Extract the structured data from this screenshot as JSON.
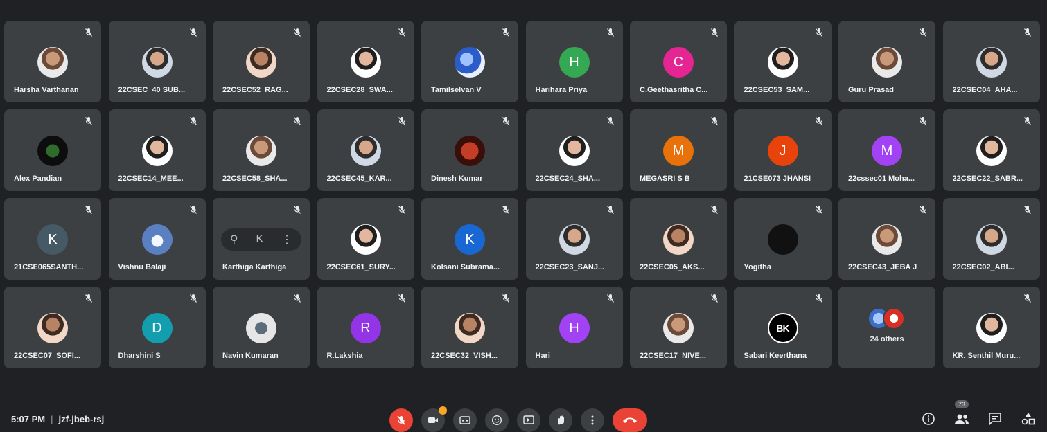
{
  "participants": [
    {
      "name": "Harsha Varthanan",
      "avatar": "photo",
      "initial": ""
    },
    {
      "name": "22CSEC_40 SUB...",
      "avatar": "photo",
      "initial": ""
    },
    {
      "name": "22CSEC52_RAG...",
      "avatar": "photo",
      "initial": ""
    },
    {
      "name": "22CSEC28_SWA...",
      "avatar": "photo",
      "initial": ""
    },
    {
      "name": "Tamilselvan V",
      "avatar": "bird",
      "initial": ""
    },
    {
      "name": "Harihara Priya",
      "avatar": "initial",
      "initial": "H",
      "color": "#34a853"
    },
    {
      "name": "C.Geethasritha C...",
      "avatar": "initial",
      "initial": "C",
      "color": "#e52592"
    },
    {
      "name": "22CSEC53_SAM...",
      "avatar": "photo",
      "initial": ""
    },
    {
      "name": "Guru Prasad",
      "avatar": "photo",
      "initial": ""
    },
    {
      "name": "22CSEC04_AHA...",
      "avatar": "photo",
      "initial": ""
    },
    {
      "name": "Alex Pandian",
      "avatar": "leaf",
      "initial": ""
    },
    {
      "name": "22CSEC14_MEE...",
      "avatar": "photo",
      "initial": ""
    },
    {
      "name": "22CSEC58_SHA...",
      "avatar": "photo",
      "initial": ""
    },
    {
      "name": "22CSEC45_KAR...",
      "avatar": "photo",
      "initial": ""
    },
    {
      "name": "Dinesh Kumar",
      "avatar": "red",
      "initial": ""
    },
    {
      "name": "22CSEC24_SHA...",
      "avatar": "photo",
      "initial": ""
    },
    {
      "name": "MEGASRI S B",
      "avatar": "initial",
      "initial": "M",
      "color": "#e8710a"
    },
    {
      "name": "21CSE073 JHANSI",
      "avatar": "initial",
      "initial": "J",
      "color": "#e8430a"
    },
    {
      "name": "22cssec01 Moha...",
      "avatar": "initial",
      "initial": "M",
      "color": "#a142f4"
    },
    {
      "name": "22CSEC22_SABR...",
      "avatar": "photo",
      "initial": ""
    },
    {
      "name": "21CSE065SANTH...",
      "avatar": "initial",
      "initial": "K",
      "color": "#455a64"
    },
    {
      "name": "Vishnu Balaji",
      "avatar": "cloud",
      "initial": ""
    },
    {
      "name": "Karthiga Karthiga",
      "avatar": "pill",
      "initial": ""
    },
    {
      "name": "22CSEC61_SURY...",
      "avatar": "photo",
      "initial": ""
    },
    {
      "name": "Kolsani Subrama...",
      "avatar": "initial",
      "initial": "K",
      "color": "#1967d2"
    },
    {
      "name": "22CSEC23_SANJ...",
      "avatar": "photo",
      "initial": ""
    },
    {
      "name": "22CSEC05_AKS...",
      "avatar": "photo",
      "initial": ""
    },
    {
      "name": "Yogitha",
      "avatar": "dark",
      "initial": ""
    },
    {
      "name": "22CSEC43_JEBA J",
      "avatar": "photo",
      "initial": ""
    },
    {
      "name": "22CSEC02_ABI...",
      "avatar": "photo",
      "initial": ""
    },
    {
      "name": "22CSEC07_SOFI...",
      "avatar": "photo",
      "initial": ""
    },
    {
      "name": "Dharshini S",
      "avatar": "initial",
      "initial": "D",
      "color": "#129eaf"
    },
    {
      "name": "Navin Kumaran",
      "avatar": "wood",
      "initial": ""
    },
    {
      "name": "R.Lakshia",
      "avatar": "initial",
      "initial": "R",
      "color": "#9334e6"
    },
    {
      "name": "22CSEC32_VISH...",
      "avatar": "photo",
      "initial": ""
    },
    {
      "name": "Hari",
      "avatar": "initial",
      "initial": "H",
      "color": "#a142f4"
    },
    {
      "name": "22CSEC17_NIVE...",
      "avatar": "photo",
      "initial": ""
    },
    {
      "name": "Sabari Keerthana",
      "avatar": "bk",
      "initial": "BK"
    },
    {
      "name": "24 others",
      "avatar": "others",
      "initial": ""
    },
    {
      "name": "KR. Senthil Muru...",
      "avatar": "photo",
      "initial": ""
    }
  ],
  "bottom_bar": {
    "time": "5:07 PM",
    "separator": "|",
    "meeting_code": "jzf-jbeb-rsj",
    "participants_count": "73"
  },
  "colors": {
    "background": "#202124",
    "tile": "#3c4043",
    "end_call": "#ea4335"
  }
}
